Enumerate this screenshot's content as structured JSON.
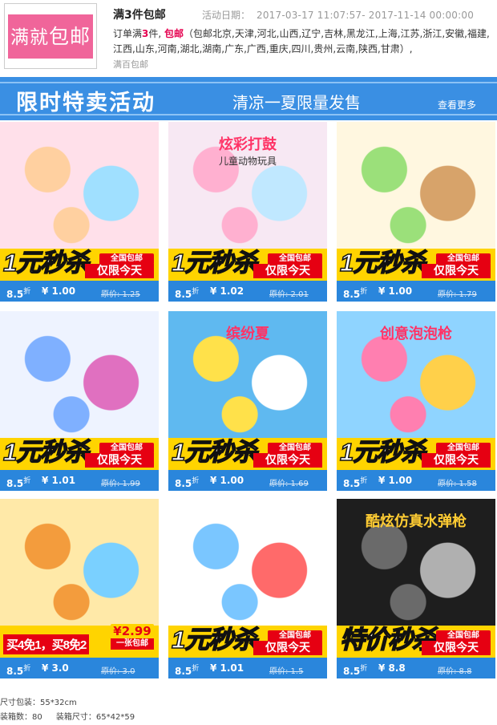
{
  "promo": {
    "badge_text_small": "满就",
    "badge_text_big": "包邮",
    "title": "满3件包邮",
    "date_label": "活动日期：",
    "date_range": "2017-03-17 11:07:57- 2017-11-14 00:00:00",
    "desc_prefix": "订单满",
    "desc_count": "3",
    "desc_mid": "件, ",
    "desc_free": "包邮",
    "desc_regions": "（包邮北京,天津,河北,山西,辽宁,吉林,黑龙江,上海,江苏,浙江,安徽,福建,江西,山东,河南,湖北,湖南,广东,广西,重庆,四川,贵州,云南,陕西,甘肃）,",
    "note": "满百包邮"
  },
  "banner": {
    "title": "限时特卖活动",
    "subtitle": "清凉一夏限量发售",
    "more": "查看更多"
  },
  "colors": {
    "accent_blue": "#2a86dc",
    "promo_pink": "#f0659a",
    "sticker_yellow": "#ffd400",
    "sticker_red": "#e60012"
  },
  "products": [
    {
      "discount": "8.5",
      "unit": "折",
      "price": "¥ 1.00",
      "original": "原价: 1.25",
      "sticker_left": "1元秒杀",
      "sticker_tag": "全国包邮",
      "sticker_right": "仅限今天"
    },
    {
      "discount": "8.5",
      "unit": "折",
      "price": "¥ 1.02",
      "original": "原价: 2.01",
      "sticker_left": "1元秒杀",
      "sticker_tag": "全国包邮",
      "sticker_right": "仅限今天",
      "top_text": "炫彩打鼓",
      "top_sub": "儿童动物玩具"
    },
    {
      "discount": "8.5",
      "unit": "折",
      "price": "¥ 1.00",
      "original": "原价: 1.79",
      "sticker_left": "1元秒杀",
      "sticker_tag": "全国包邮",
      "sticker_right": "仅限今天"
    },
    {
      "discount": "8.5",
      "unit": "折",
      "price": "¥ 1.01",
      "original": "原价: 1.99",
      "sticker_left": "1元秒杀",
      "sticker_tag": "全国包邮",
      "sticker_right": "仅限今天"
    },
    {
      "discount": "8.5",
      "unit": "折",
      "price": "¥ 1.00",
      "original": "原价: 1.69",
      "sticker_left": "1元秒杀",
      "sticker_tag": "全国包邮",
      "sticker_right": "仅限今天",
      "top_text": "缤纷夏"
    },
    {
      "discount": "8.5",
      "unit": "折",
      "price": "¥ 1.00",
      "original": "原价: 1.58",
      "sticker_left": "1元秒杀",
      "sticker_tag": "全国包邮",
      "sticker_right": "仅限今天",
      "top_text": "创意泡泡枪"
    },
    {
      "discount": "8.5",
      "unit": "折",
      "price": "¥ 3.0",
      "original": "原价: 3.0",
      "sticker_left": "买4免1，买8免2",
      "sticker_tag": "¥2.99",
      "sticker_right": "一张包邮"
    },
    {
      "discount": "8.5",
      "unit": "折",
      "price": "¥ 1.01",
      "original": "原价: 1.5",
      "sticker_left": "1元秒杀",
      "sticker_tag": "全国包邮",
      "sticker_right": "仅限今天"
    },
    {
      "discount": "8.5",
      "unit": "折",
      "price": "¥ 8.8",
      "original": "原价: 8.8",
      "sticker_left": "特价秒杀",
      "sticker_tag": "全国包邮",
      "sticker_right": "仅限今天",
      "top_text": "酷炫仿真水弹枪"
    }
  ],
  "footer": {
    "size": "尺寸包装：55*32cm",
    "box_count": "装箱数：80",
    "box_size": "装箱尺寸：65*42*59"
  }
}
